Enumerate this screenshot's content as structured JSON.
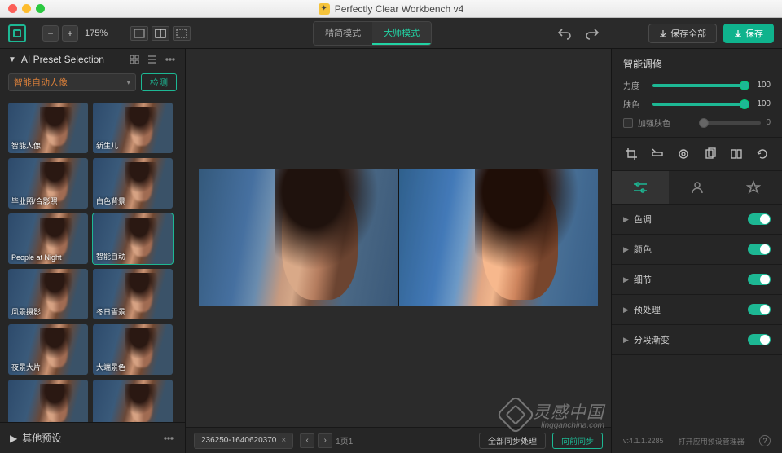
{
  "window": {
    "title": "Perfectly Clear Workbench v4"
  },
  "topbar": {
    "zoom_minus": "−",
    "zoom_plus": "+",
    "zoom_value": "175%",
    "mode_simple": "精简模式",
    "mode_master": "大师模式",
    "save_all": "保存全部",
    "save": "保存"
  },
  "left": {
    "panel_title": "AI Preset Selection",
    "dropdown_value": "智能自动人像",
    "detect_btn": "检测",
    "presets": [
      [
        "智能人像",
        "新生儿"
      ],
      [
        "毕业照/合影照",
        "白色背景"
      ],
      [
        "People at Night",
        "智能自动"
      ],
      [
        "风景摄影",
        "冬日雪景"
      ],
      [
        "夜景大片",
        "大端景色"
      ],
      [
        "",
        ""
      ]
    ],
    "selected": "智能自动",
    "other_presets": "其他预设"
  },
  "center": {
    "filename": "236250-1640620370",
    "page_text": "1页1",
    "process_all": "全部同步处理",
    "sync_back": "向前同步"
  },
  "right": {
    "section_title": "智能调修",
    "slider1_label": "力度",
    "slider1_value": "100",
    "slider2_label": "肤色",
    "slider2_value": "100",
    "chk_label": "加强肤色",
    "chk_value": "0",
    "accordions": [
      "色调",
      "颜色",
      "细节",
      "预处理",
      "分段渐变"
    ],
    "version": "v:4.1.1.2285",
    "footer_link": "打开应用预设管理器"
  },
  "watermark": {
    "line1": "灵感中国",
    "line2": "lingganchina",
    "line3": ".com"
  }
}
